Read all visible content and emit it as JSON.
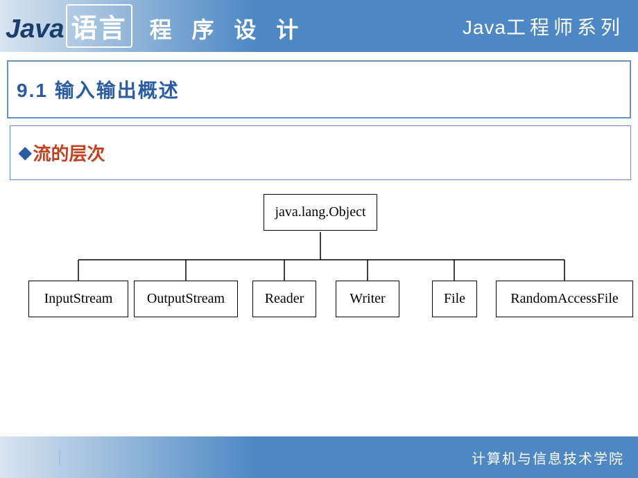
{
  "header": {
    "java": "Java",
    "yuyan": "语言",
    "chengxu": "程 序 设 计",
    "right_java": "Java",
    "right_text": "工程师系列"
  },
  "section": {
    "title": "9.1  输入输出概述"
  },
  "subsection": {
    "bullet": "◆",
    "text": "流的层次"
  },
  "diagram": {
    "root": "java.lang.Object",
    "children": [
      "InputStream",
      "OutputStream",
      "Reader",
      "Writer",
      "File",
      "RandomAccessFile"
    ]
  },
  "footer": {
    "text": "计算机与信息技术学院",
    "divider": "|"
  }
}
